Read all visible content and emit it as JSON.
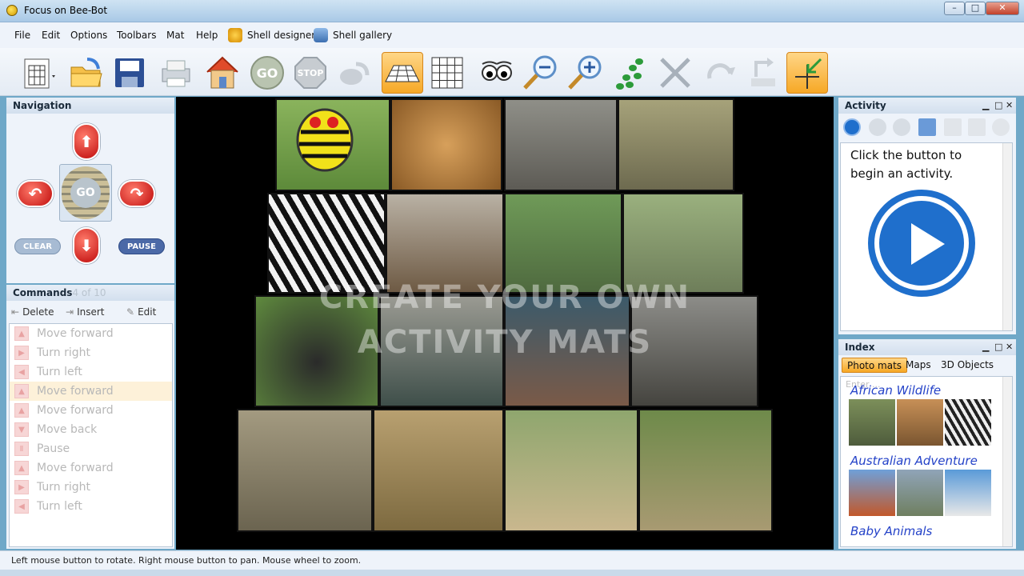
{
  "window": {
    "title": "Focus on Bee-Bot",
    "controls": [
      "–",
      "□",
      "✕"
    ]
  },
  "menu": {
    "items": [
      "File",
      "Edit",
      "Options",
      "Toolbars",
      "Mat",
      "Help"
    ],
    "shell_designer": "Shell designer",
    "shell_gallery": "Shell gallery"
  },
  "toolbar": {
    "buttons": [
      {
        "icon": "new-mat-icon"
      },
      {
        "icon": "open-folder-icon"
      },
      {
        "icon": "save-icon"
      },
      {
        "icon": "print-icon"
      },
      {
        "icon": "home-icon"
      },
      {
        "icon": "go-icon"
      },
      {
        "icon": "stop-icon"
      },
      {
        "icon": "rotate-view-icon"
      },
      {
        "icon": "perspective-view-icon"
      },
      {
        "icon": "grid-view-icon"
      },
      {
        "icon": "look-eyes-icon"
      },
      {
        "icon": "zoom-out-icon"
      },
      {
        "icon": "zoom-in-icon"
      },
      {
        "icon": "footsteps-icon"
      },
      {
        "icon": "delete-x-icon"
      },
      {
        "icon": "redo-icon"
      },
      {
        "icon": "reset-icon"
      },
      {
        "icon": "target-cross-icon"
      }
    ]
  },
  "navigation": {
    "title": "Navigation",
    "go_label": "GO",
    "clear_label": "CLEAR",
    "pause_label": "PAUSE"
  },
  "commands": {
    "title": "Commands",
    "counter": "4 of 10",
    "delete_label": "Delete",
    "insert_label": "Insert",
    "edit_label": "Edit",
    "items": [
      {
        "label": "Move forward",
        "icon": "▲"
      },
      {
        "label": "Turn right",
        "icon": "▶"
      },
      {
        "label": "Turn left",
        "icon": "◀"
      },
      {
        "label": "Move forward",
        "icon": "▲"
      },
      {
        "label": "Move forward",
        "icon": "▲"
      },
      {
        "label": "Move back",
        "icon": "▼"
      },
      {
        "label": "Pause",
        "icon": "Ⅱ"
      },
      {
        "label": "Move forward",
        "icon": "▲"
      },
      {
        "label": "Turn right",
        "icon": "▶"
      },
      {
        "label": "Turn left",
        "icon": "◀"
      }
    ],
    "selected_index": 3
  },
  "viewport": {
    "overlay_line1": "CREATE YOUR OWN",
    "overlay_line2": "ACTIVITY MATS"
  },
  "activity": {
    "title": "Activity",
    "text": "Click the button to begin an activity."
  },
  "index": {
    "title": "Index",
    "tabs": [
      "Photo mats",
      "Maps",
      "3D Objects"
    ],
    "active_tab": "Photo mats",
    "search_placeholder": "Enter ...",
    "categories": [
      "African Wildlife",
      "Australian Adventure",
      "Baby Animals"
    ]
  },
  "status": {
    "text": "Left mouse button to rotate.  Right mouse button to pan.  Mouse wheel to zoom."
  },
  "colors": {
    "accent_orange": "#f6a826",
    "bee_red": "#c00d0d",
    "play_blue": "#1f6fcc",
    "index_link": "#2442c8"
  }
}
